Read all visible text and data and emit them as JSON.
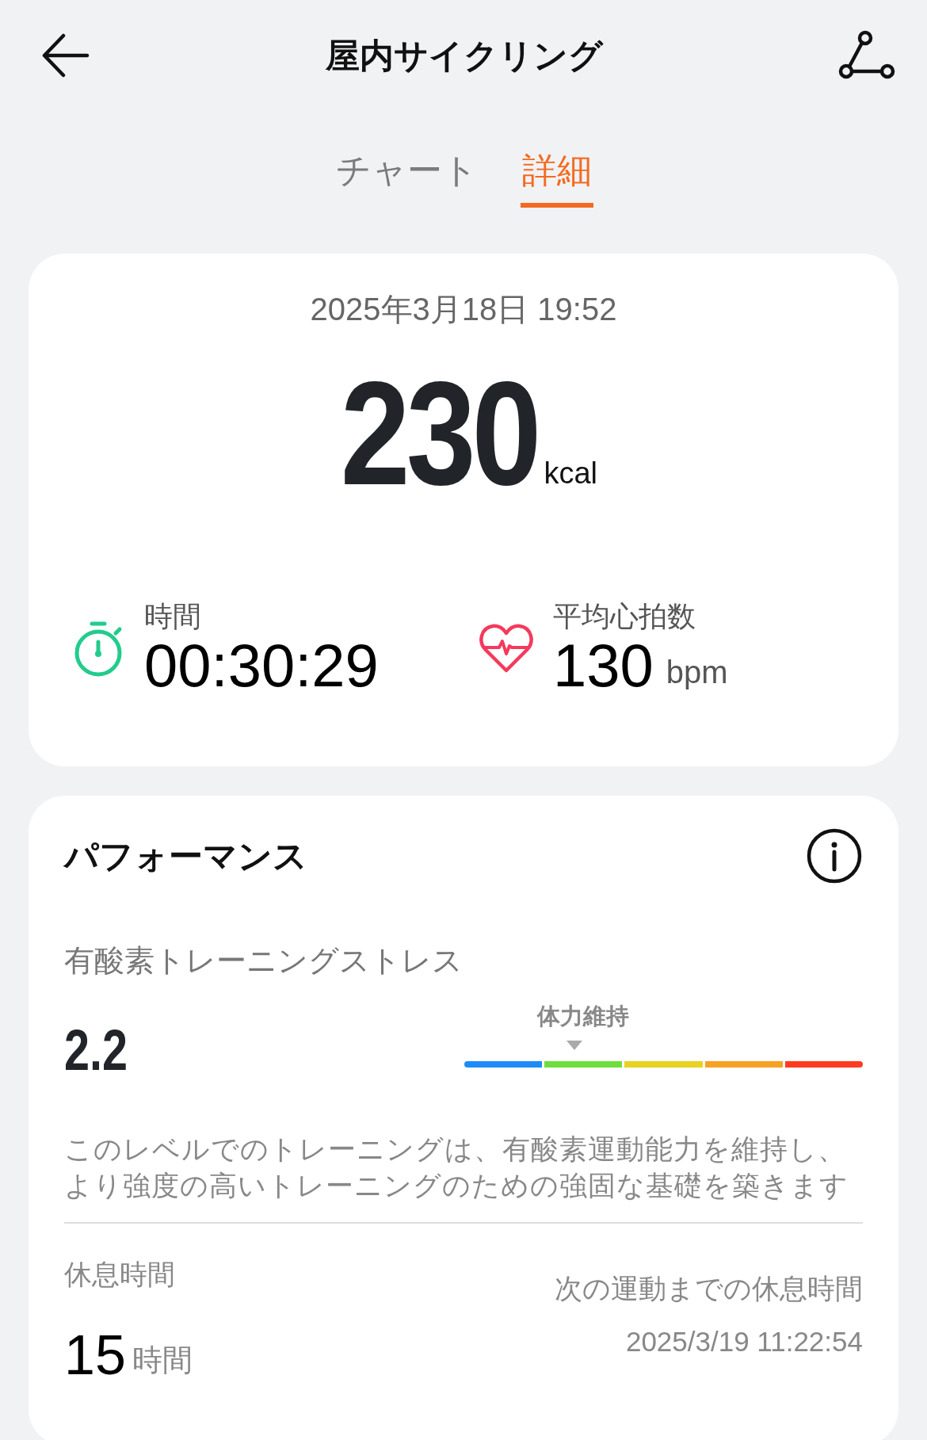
{
  "header": {
    "title": "屋内サイクリング"
  },
  "tabs": [
    {
      "label": "チャート",
      "selected": false
    },
    {
      "label": "詳細",
      "selected": true
    }
  ],
  "summary": {
    "datetime": "2025年3月18日 19:52",
    "calories": "230",
    "calories_unit": "kcal",
    "stats": [
      {
        "kind": "timer",
        "label": "時間",
        "value": "00:30:29"
      },
      {
        "kind": "heart",
        "label": "平均心拍数",
        "value": "130",
        "unit": "bpm"
      }
    ]
  },
  "performance": {
    "title": "パフォーマンス",
    "metric_label": "有酸素トレーニングストレス",
    "metric_value": "2.2",
    "gauge_label": "体力維持",
    "segments": [
      {
        "color": "#1e8cf8",
        "selected": false
      },
      {
        "color": "#6ede3c",
        "selected": true
      },
      {
        "color": "#e8d222",
        "selected": false
      },
      {
        "color": "#f6a323",
        "selected": false
      },
      {
        "color": "#ff3b22",
        "selected": false
      }
    ],
    "description": "このレベルでのトレーニングは、有酸素運動能力を維持し、より強度の高いトレーニングのための強固な基礎を築きます",
    "rest_label": "休息時間",
    "rest_value": "15",
    "rest_unit": "時間",
    "next_label": "次の運動までの休息時間",
    "next_value": "2025/3/19 11:22:54"
  }
}
